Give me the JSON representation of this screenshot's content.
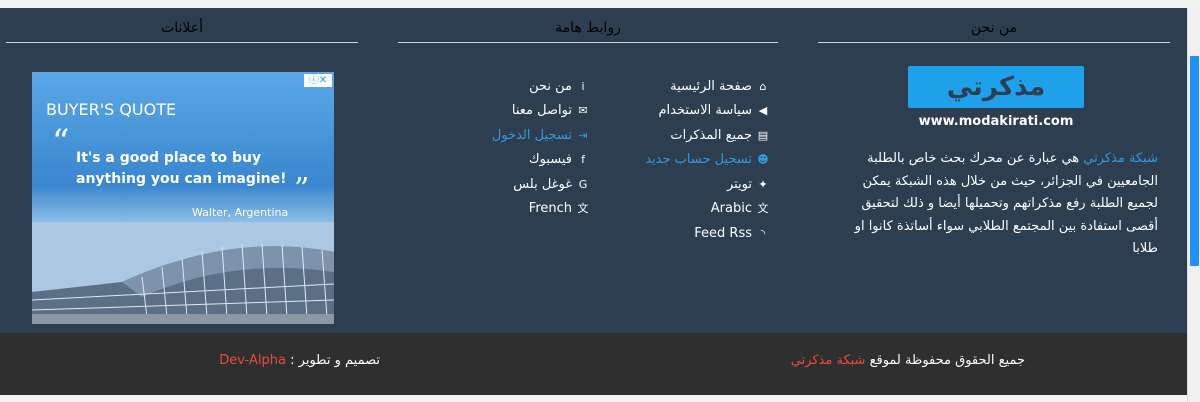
{
  "about": {
    "title": "من نحن",
    "logo_word": "مذكرتي",
    "logo_url": "www.modakirati.com",
    "brand": "شبكة مذكرتي",
    "text": " هي عبارة عن محرك بحث خاص بالطلبة الجامعيين في الجزائر، حيث من خلال هذه الشبكة يمكن لجميع الطلبة رفع مذكراتهم وتحميلها أيضا و ذلك لتحقيق أقصى استفادة بين المجتمع الطلابي سواء أساتذة كانوا او طلابا"
  },
  "links": {
    "title": "روابط هامة",
    "right": [
      {
        "label": "صفحة الرئيسية",
        "icon": "⌂"
      },
      {
        "label": "سياسة الاستخدام",
        "icon": "◀"
      },
      {
        "label": "جميع المذكرات",
        "icon": "▤"
      },
      {
        "label": "تسجيل حساب جديد",
        "icon": "☻"
      },
      {
        "label": "تويتر",
        "icon": "✦"
      },
      {
        "label": "Arabic",
        "icon": "文"
      },
      {
        "label": "Feed Rss",
        "icon": "◝"
      }
    ],
    "left": [
      {
        "label": "من نحن",
        "icon": "i"
      },
      {
        "label": "تواصل معنا",
        "icon": "✉"
      },
      {
        "label": "تسجيل الدخول",
        "icon": "⇥"
      },
      {
        "label": "فيسبوك",
        "icon": "f"
      },
      {
        "label": "غوغل بلس",
        "icon": "G"
      },
      {
        "label": "French",
        "icon": "文"
      }
    ]
  },
  "ads": {
    "title": "أعلانات",
    "info_badge": "ⓘ✕",
    "headline": "BUYER'S QUOTE",
    "quote_open": "“",
    "quote": "It's a good place to buy anything you can imagine!",
    "quote_close": "”",
    "author": "Walter, Argentina"
  },
  "footer": {
    "copyright_text": "جميع الحقوق محفوظة لموقع ",
    "copyright_brand": "شبكة مذكرتي",
    "credits_text": "تصميم و تطوير : ",
    "credits_brand": "Dev-Alpha"
  },
  "colors": {
    "footer_bg": "#2c3e50",
    "bottom_bg": "#2f2f2f",
    "link_accent": "#3498db",
    "brand_red": "#e74c3c",
    "scroll_thumb": "#1e90ff"
  }
}
